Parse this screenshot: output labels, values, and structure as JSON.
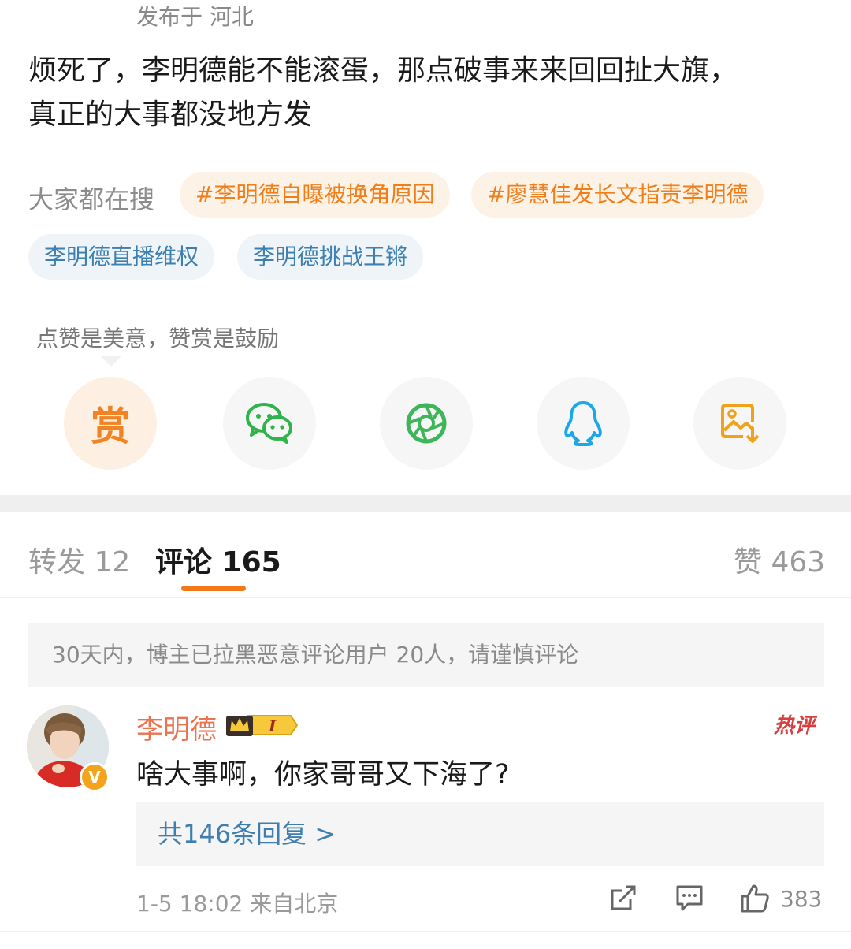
{
  "post": {
    "location": "发布于 河北",
    "text_line1": "烦死了，李明德能不能滚蛋，那点破事来来回回扯大旗，",
    "text_line2": "真正的大事都没地方发"
  },
  "search": {
    "label": "大家都在搜",
    "chips": [
      "#李明德自曝被换角原因",
      "#廖慧佳发长文指责李明德",
      "李明德直播维权",
      "李明德挑战王锵"
    ]
  },
  "reward": {
    "tip": "点赞是美意，赞赏是鼓励",
    "reward_char": "赏"
  },
  "share_icons": [
    "reward-icon",
    "wechat-icon",
    "moments-icon",
    "qq-icon",
    "save-image-icon"
  ],
  "tabs": {
    "repost": "转发 12",
    "comments": "评论 165",
    "likes": "赞 463"
  },
  "notice": "30天内，博主已拉黑恶意评论用户 20人，请谨慎评论",
  "comment": {
    "username": "李明德",
    "verified_mark": "V",
    "badge_level": "I",
    "hot_label": "热评",
    "text": "啥大事啊，你家哥哥又下海了?",
    "replies": "共146条回复 >",
    "meta": "1-5 18:02  来自北京",
    "like_count": "383"
  },
  "colors": {
    "accent_orange": "#f07a1b",
    "username": "#eb7350",
    "link_blue": "#3f7fb0",
    "hot_red": "#d73e3e"
  }
}
